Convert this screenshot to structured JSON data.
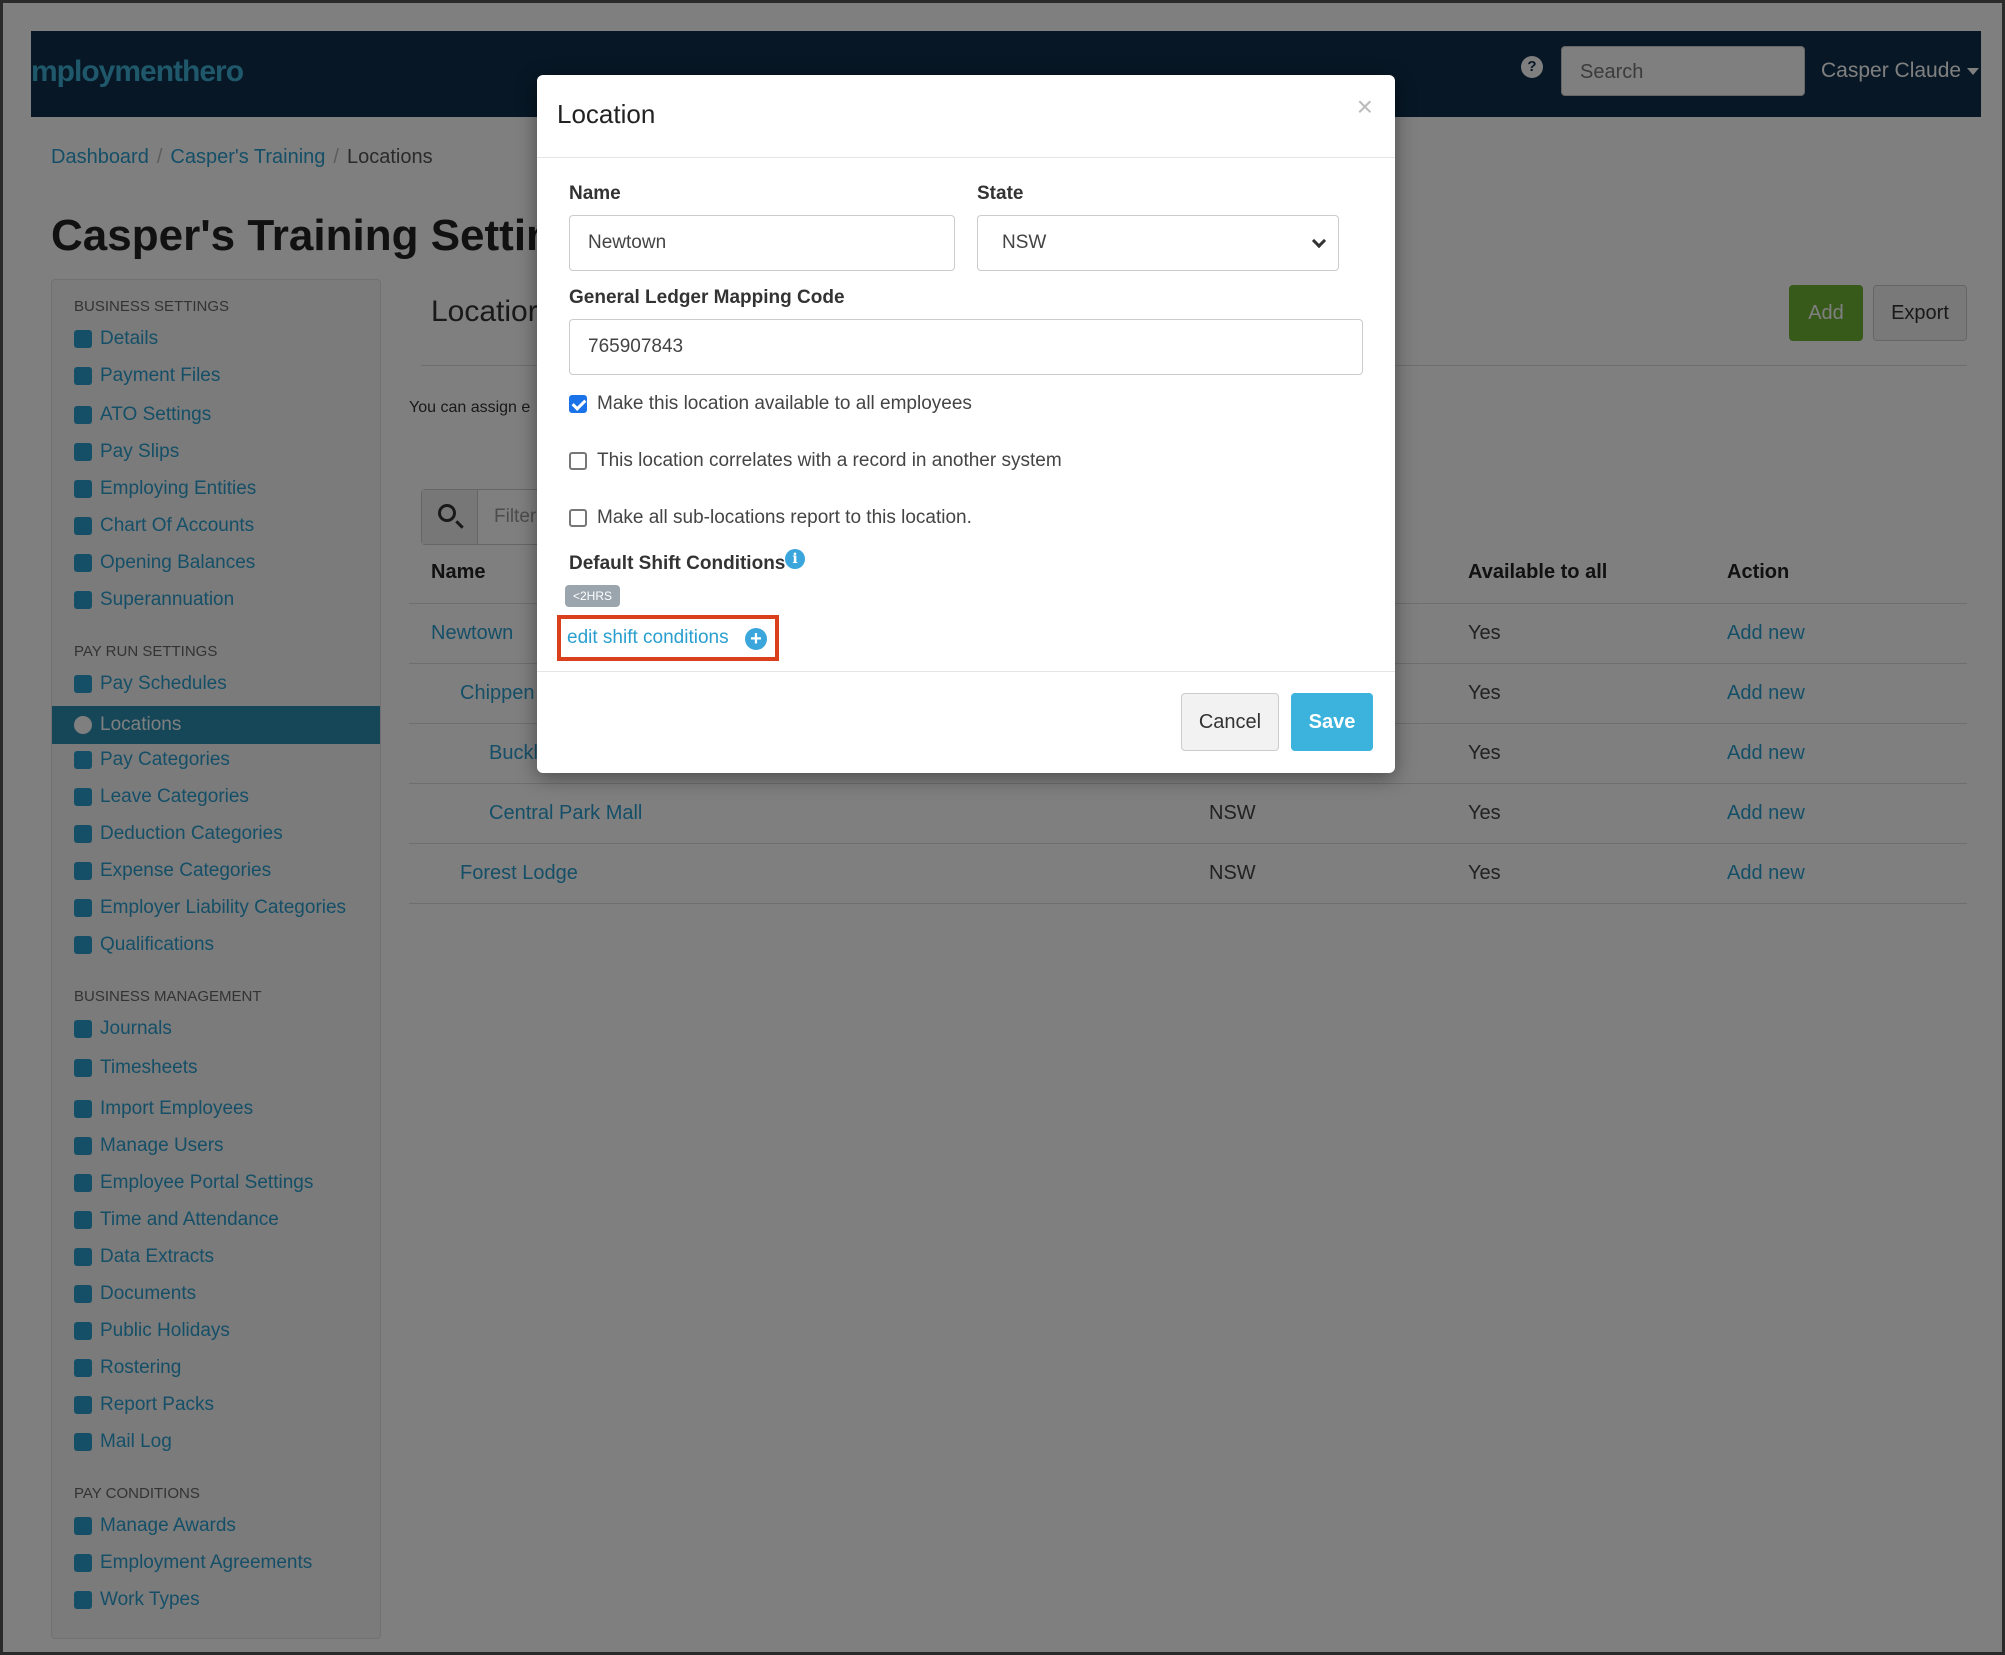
{
  "navbar": {
    "brand": "mploymenthero",
    "help_icon": "question-circle-icon",
    "search_placeholder": "Search",
    "user_name": "Casper Claude"
  },
  "breadcrumb": {
    "items": [
      "Dashboard",
      "Casper's Training"
    ],
    "current": "Locations"
  },
  "page_title": "Casper's Training Settings",
  "sidebar": {
    "business_settings_heading": "BUSINESS SETTINGS",
    "business_settings": [
      {
        "label": "Details",
        "icon": "gear-icon"
      },
      {
        "label": "Payment Files",
        "icon": "save-icon"
      },
      {
        "label": "ATO Settings",
        "icon": "balance-icon"
      },
      {
        "label": "Pay Slips",
        "icon": "file-icon"
      },
      {
        "label": "Employing Entities",
        "icon": "bank-icon"
      },
      {
        "label": "Chart Of Accounts",
        "icon": "list-icon"
      },
      {
        "label": "Opening Balances",
        "icon": "leaf-icon"
      },
      {
        "label": "Superannuation",
        "icon": "lifebuoy-icon"
      }
    ],
    "pay_run_settings_heading": "PAY RUN SETTINGS",
    "pay_run_settings": [
      {
        "label": "Pay Schedules",
        "icon": "calendar-icon"
      },
      {
        "label": "Locations",
        "icon": "globe-icon",
        "active": true
      },
      {
        "label": "Pay Categories",
        "icon": "money-icon"
      },
      {
        "label": "Leave Categories",
        "icon": "plane-icon"
      },
      {
        "label": "Deduction Categories",
        "icon": "minus-circle-icon"
      },
      {
        "label": "Expense Categories",
        "icon": "archive-icon"
      },
      {
        "label": "Employer Liability Categories",
        "icon": "industry-icon"
      },
      {
        "label": "Qualifications",
        "icon": "check-icon"
      }
    ],
    "business_management_heading": "BUSINESS MANAGEMENT",
    "business_management": [
      {
        "label": "Journals",
        "icon": "columns-icon"
      },
      {
        "label": "Timesheets",
        "icon": "clock-icon"
      },
      {
        "label": "Import Employees",
        "icon": "users-icon"
      },
      {
        "label": "Manage Users",
        "icon": "lock-icon"
      },
      {
        "label": "Employee Portal Settings",
        "icon": "magic-wand-icon"
      },
      {
        "label": "Time and Attendance",
        "icon": "stopwatch-icon"
      },
      {
        "label": "Data Extracts",
        "icon": "cloud-download-icon"
      },
      {
        "label": "Documents",
        "icon": "folder-icon"
      },
      {
        "label": "Public Holidays",
        "icon": "calendar-icon"
      },
      {
        "label": "Rostering",
        "icon": "calendar-check-icon"
      },
      {
        "label": "Report Packs",
        "icon": "folder-open-icon"
      },
      {
        "label": "Mail Log",
        "icon": "envelope-icon"
      }
    ],
    "pay_conditions_heading": "PAY CONDITIONS",
    "pay_conditions": [
      {
        "label": "Manage Awards",
        "icon": "exchange-icon"
      },
      {
        "label": "Employment Agreements",
        "icon": "star-icon"
      },
      {
        "label": "Work Types",
        "icon": "book-icon"
      }
    ]
  },
  "main": {
    "section_title": "Locatior",
    "add_label": "Add",
    "export_label": "Export",
    "intro": "You can assign e",
    "filter_placeholder": "Filter",
    "columns": {
      "name": "Name",
      "available": "Available to all",
      "action": "Action"
    },
    "rows": [
      {
        "name": "Newtown",
        "state": "",
        "available": "Yes",
        "action": "Add new"
      },
      {
        "name": "Chippen",
        "state": "",
        "available": "Yes",
        "action": "Add new"
      },
      {
        "name": "Buckl",
        "state": "",
        "available": "Yes",
        "action": "Add new"
      },
      {
        "name": "Central Park Mall",
        "state": "NSW",
        "available": "Yes",
        "action": "Add new"
      },
      {
        "name": "Forest Lodge",
        "state": "NSW",
        "available": "Yes",
        "action": "Add new"
      }
    ]
  },
  "modal": {
    "title": "Location",
    "close": "×",
    "name_label": "Name",
    "name_value": "Newtown",
    "state_label": "State",
    "state_value": "NSW",
    "gl_label": "General Ledger Mapping Code",
    "gl_value": "765907843",
    "checkbox_all_employees": {
      "label": "Make this location available to all employees",
      "checked": true
    },
    "checkbox_correlates": {
      "label": "This location correlates with a record in another system",
      "checked": false
    },
    "checkbox_sublocations": {
      "label": "Make all sub-locations report to this location.",
      "checked": false
    },
    "shift_conditions_label": "Default Shift Conditions",
    "shift_badge": "<2HRS",
    "edit_shift_link": "edit shift conditions",
    "cancel_label": "Cancel",
    "save_label": "Save"
  }
}
